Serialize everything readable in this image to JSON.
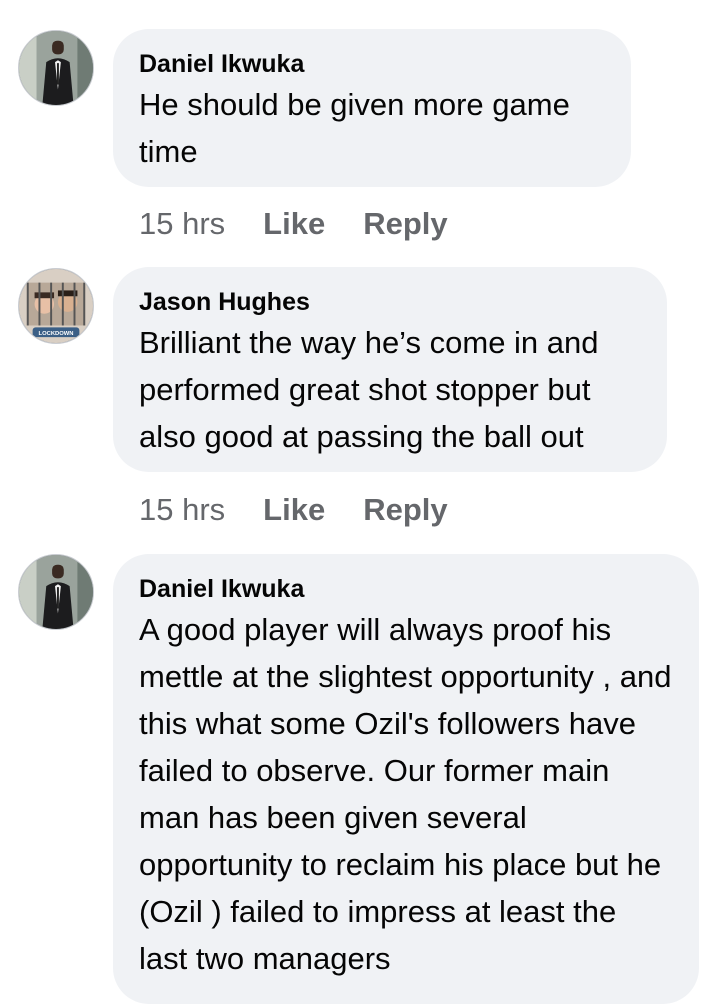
{
  "comments": [
    {
      "author": "Daniel Ikwuka",
      "text": "He should be given more game time",
      "time": "15 hrs",
      "like_label": "Like",
      "reply_label": "Reply",
      "avatar": "man-in-suit-avatar"
    },
    {
      "author": "Jason Hughes",
      "text": "Brilliant the way he’s come in and performed great shot stopper but also good at passing the ball out",
      "time": "15 hrs",
      "like_label": "Like",
      "reply_label": "Reply",
      "avatar": "lockdown-frame-avatar",
      "avatar_caption": "LOCKDOWN"
    },
    {
      "author": "Daniel Ikwuka",
      "text": "A good player will always proof his mettle at the slightest opportunity , and this what some Ozil's followers have failed to observe. Our former main man has been given several opportunity to reclaim his place but he (Ozil ) failed to impress at least the last two managers",
      "avatar": "man-in-suit-avatar"
    }
  ],
  "colors": {
    "bubble_bg": "#f0f2f5",
    "text": "#050505",
    "meta": "#65676b"
  }
}
